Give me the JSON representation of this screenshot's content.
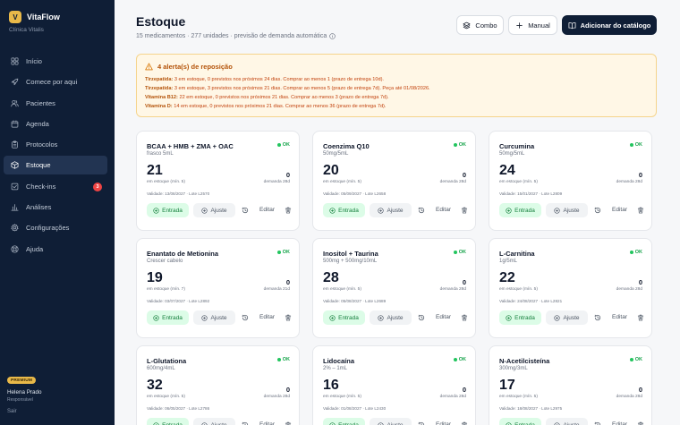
{
  "brand": {
    "logo_letter": "V",
    "name": "VitaFlow",
    "clinic": "Clínica Vitalis"
  },
  "nav": [
    {
      "label": "Início",
      "icon": "dashboard-icon",
      "active": false
    },
    {
      "label": "Comece por aqui",
      "icon": "rocket-icon",
      "active": false
    },
    {
      "label": "Pacientes",
      "icon": "users-icon",
      "active": false
    },
    {
      "label": "Agenda",
      "icon": "calendar-icon",
      "active": false
    },
    {
      "label": "Protocolos",
      "icon": "clipboard-icon",
      "active": false
    },
    {
      "label": "Estoque",
      "icon": "box-icon",
      "active": true
    },
    {
      "label": "Check-ins",
      "icon": "checkbox-icon",
      "active": false,
      "badge": "3"
    },
    {
      "label": "Análises",
      "icon": "bar-chart-icon",
      "active": false
    },
    {
      "label": "Configurações",
      "icon": "gear-icon",
      "active": false
    },
    {
      "label": "Ajuda",
      "icon": "help-icon",
      "active": false
    }
  ],
  "account": {
    "plan": "PREMIUM",
    "name": "Helena Prado",
    "role": "Responsável",
    "logout": "Sair"
  },
  "header": {
    "title": "Estoque",
    "subtitle": "15 medicamentos · 277 unidades · previsão de demanda automática",
    "combo_label": "Combo",
    "manual_label": "Manual",
    "catalog_label": "Adicionar do catálogo"
  },
  "alert": {
    "title": "4 alerta(s) de reposição",
    "lines": [
      {
        "name": "Tirzepatida:",
        "text": " 3 em estoque, 0 previstos nos próximos 24 dias. Comprar ao menos 1 (prazo de entrega 10d)."
      },
      {
        "name": "Tirzepatida:",
        "text": " 3 em estoque, 3 previstos nos próximos 21 dias. Comprar ao menos 5 (prazo de entrega 7d). Peça até 01/08/2026."
      },
      {
        "name": "Vitamina B12:",
        "text": " 22 em estoque, 0 previstos nos próximos 21 dias. Comprar ao menos 3 (prazo de entrega 7d)."
      },
      {
        "name": "Vitamina D:",
        "text": " 14 em estoque, 0 previstos nos próximos 21 dias. Comprar ao menos 36 (prazo de entrega 7d)."
      }
    ]
  },
  "card_labels": {
    "status": "OK",
    "entrada": "Entrada",
    "ajuste": "Ajuste",
    "editar": "Editar"
  },
  "cards": [
    {
      "name": "BCAA + HMB + ZMA + OAC",
      "variant": "frasco 5mL",
      "stock": "21",
      "stock_label": "em estoque (mín. 5)",
      "demand": "0",
      "demand_label": "demanda 28d",
      "meta": "Validade: 13/08/2027 · Lote L2570"
    },
    {
      "name": "Coenzima Q10",
      "variant": "50mg/5mL",
      "stock": "20",
      "stock_label": "em estoque (mín. 5)",
      "demand": "0",
      "demand_label": "demanda 28d",
      "meta": "Validade: 05/09/2027 · Lote L2658"
    },
    {
      "name": "Curcumina",
      "variant": "50mg/5mL",
      "stock": "24",
      "stock_label": "em estoque (mín. 5)",
      "demand": "0",
      "demand_label": "demanda 28d",
      "meta": "Validade: 15/01/2027 · Lote L2809"
    },
    {
      "name": "Enantato de Metionina",
      "variant": "Crescer cabelo",
      "stock": "19",
      "stock_label": "em estoque (mín. 7)",
      "demand": "0",
      "demand_label": "demanda 21d",
      "meta": "Validade: 03/07/2027 · Lote L2892"
    },
    {
      "name": "Inositol + Taurina",
      "variant": "500mg + 500mg/10mL",
      "stock": "28",
      "stock_label": "em estoque (mín. 5)",
      "demand": "0",
      "demand_label": "demanda 28d",
      "meta": "Validade: 05/08/2027 · Lote L2689"
    },
    {
      "name": "L-Carnitina",
      "variant": "1g/5mL",
      "stock": "22",
      "stock_label": "em estoque (mín. 5)",
      "demand": "0",
      "demand_label": "demanda 28d",
      "meta": "Validade: 24/08/2027 · Lote L2821"
    },
    {
      "name": "L-Glutationa",
      "variant": "600mg/4mL",
      "stock": "32",
      "stock_label": "em estoque (mín. 5)",
      "demand": "0",
      "demand_label": "demanda 28d",
      "meta": "Validade: 06/05/2027 · Lote L2786"
    },
    {
      "name": "Lidocaína",
      "variant": "2% – 1mL",
      "stock": "16",
      "stock_label": "em estoque (mín. 5)",
      "demand": "0",
      "demand_label": "demanda 28d",
      "meta": "Validade: 01/08/2027 · Lote L2430"
    },
    {
      "name": "N-Acetilcisteína",
      "variant": "300mg/3mL",
      "stock": "17",
      "stock_label": "em estoque (mín. 5)",
      "demand": "0",
      "demand_label": "demanda 28d",
      "meta": "Validade: 18/08/2027 · Lote L2975"
    }
  ]
}
